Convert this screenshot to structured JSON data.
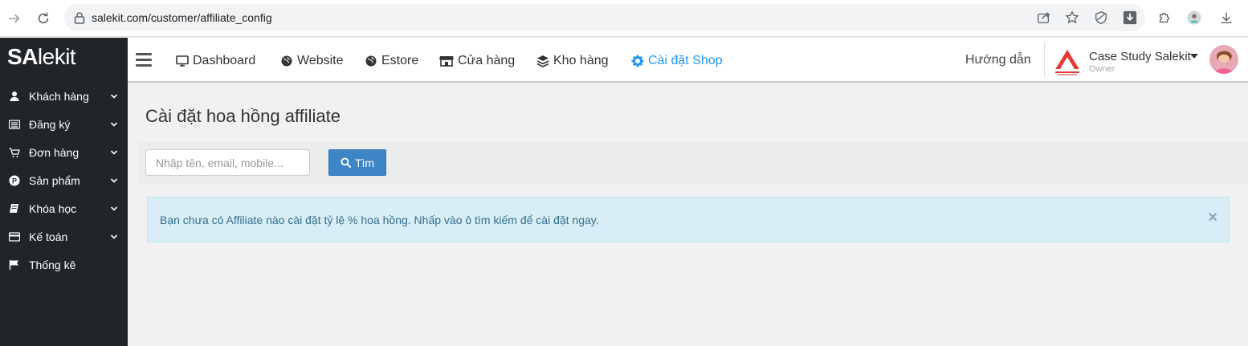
{
  "browser": {
    "url": "salekit.com/customer/affiliate_config"
  },
  "brand": {
    "logo_part1": "SA",
    "logo_part2": "lekit"
  },
  "sidebar": {
    "items": [
      {
        "label": "Khách hàng",
        "icon": "user-icon"
      },
      {
        "label": "Đăng ký",
        "icon": "list-icon"
      },
      {
        "label": "Đơn hàng",
        "icon": "cart-icon"
      },
      {
        "label": "Sản phẩm",
        "icon": "product-icon"
      },
      {
        "label": "Khóa học",
        "icon": "book-icon"
      },
      {
        "label": "Kế toán",
        "icon": "card-icon"
      },
      {
        "label": "Thống kê",
        "icon": "flag-icon"
      }
    ]
  },
  "topnav": {
    "items": [
      {
        "label": "Dashboard",
        "icon": "monitor-icon"
      },
      {
        "label": "Website",
        "icon": "globe-icon"
      },
      {
        "label": "Estore",
        "icon": "globe-icon"
      },
      {
        "label": "Cửa hàng",
        "icon": "store-icon"
      },
      {
        "label": "Kho hàng",
        "icon": "layers-icon"
      },
      {
        "label": "Cài đặt Shop",
        "icon": "gear-icon"
      }
    ],
    "guide": "Hướng dẫn",
    "shop_name": "Case Study Salekit",
    "shop_role": "Owner"
  },
  "main": {
    "title": "Cài đặt hoa hồng affiliate",
    "search_placeholder": "Nhập tên, email, mobile...",
    "search_button": "Tìm",
    "alert_text": "Bạn chưa có Affiliate nào cài đặt tỷ lệ % hoa hồng. Nhấp vào ô tìm kiếm để cài đặt ngay.",
    "alert_close": "×"
  },
  "colors": {
    "sidebar_bg": "#212529",
    "active_nav": "#2196f3",
    "primary_button": "#3d85c6",
    "alert_bg": "#d9edf7",
    "alert_text": "#31708f"
  }
}
